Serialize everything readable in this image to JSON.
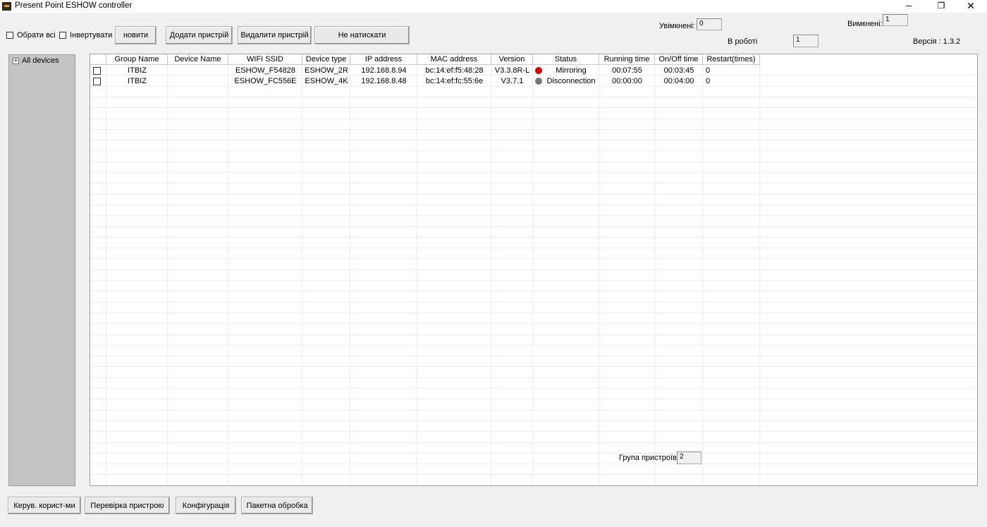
{
  "window": {
    "title": "Present Point ESHOW controller",
    "minimize": "─",
    "maximize": "❐",
    "close": "✕"
  },
  "toolbar": {
    "select_all_label": "Обрати всі",
    "invert_label": "Інвертувати",
    "refresh_label": "новити",
    "add_device_label": "Додати пристрій",
    "delete_device_label": "Видалити пристрій",
    "do_not_press_label": "Не натискати"
  },
  "stats": {
    "enabled_label": "Увімкнені:",
    "enabled_value": "0",
    "disabled_label": "Вимкнені:",
    "disabled_value": "1",
    "in_work_label": "В роботі",
    "in_work_value": "1",
    "version_label": "Версія : 1.3.2"
  },
  "tree": {
    "root_label": "All devices",
    "expander": "+"
  },
  "table": {
    "columns": [
      "Group Name",
      "Device Name",
      "WIFI SSID",
      "Device type",
      "IP address",
      "MAC address",
      "Version",
      "Status",
      "Running time",
      "On/Off time",
      "Restart(times)"
    ],
    "rows": [
      {
        "group": "ITBIZ",
        "device_name": "",
        "ssid": "ESHOW_F54828",
        "type": "ESHOW_2R",
        "ip": "192.168.8.94",
        "mac": "bc:14:ef:f5:48:28",
        "version": "V3.3.8R-L",
        "status_color": "#e00000",
        "status": "Mirroring",
        "running": "00:07:55",
        "onoff": "00:03:45",
        "restart": "0"
      },
      {
        "group": "ITBIZ",
        "device_name": "",
        "ssid": "ESHOW_FC556E",
        "type": "ESHOW_4K",
        "ip": "192.168.8.48",
        "mac": "bc:14:ef:fc:55:6e",
        "version": "V3.7.1",
        "status_color": "#777777",
        "status": "Disconnection",
        "running": "00:00:00",
        "onoff": "00:04:00",
        "restart": "0"
      }
    ]
  },
  "group_count": {
    "label": "Група пристроїв",
    "value": "2"
  },
  "bottom_buttons": {
    "user_mgmt": "Керув. корист-ми",
    "device_check": "Перевірка пристрою",
    "configuration": "Конфігурація",
    "batch": "Пакетна обробка"
  }
}
